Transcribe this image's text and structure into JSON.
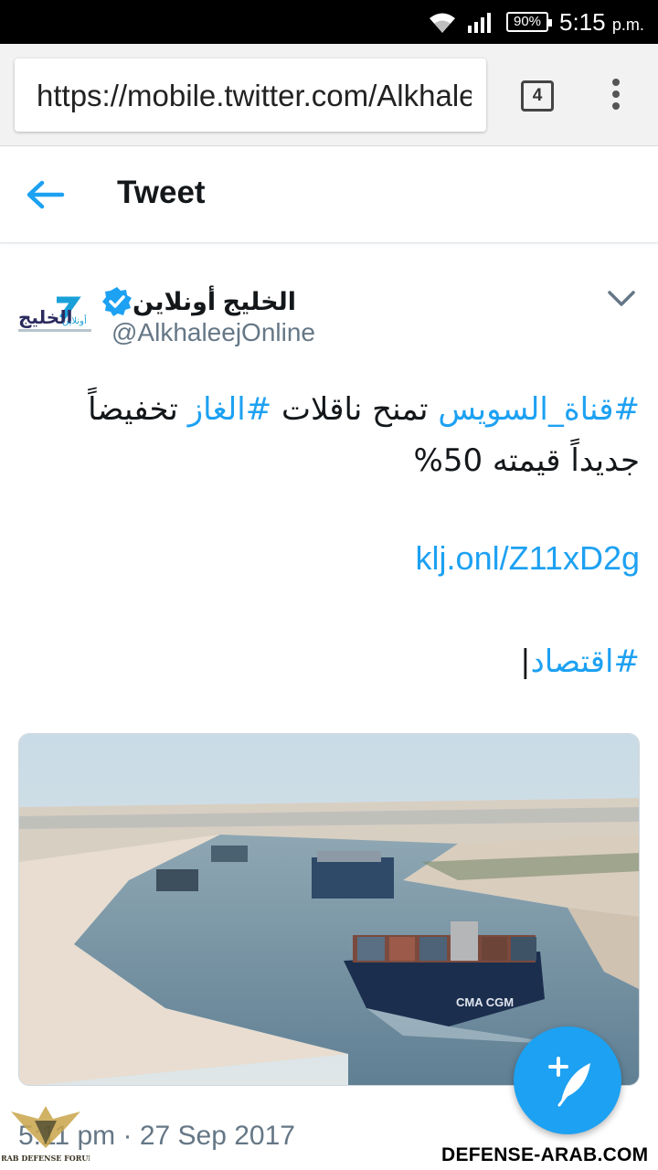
{
  "status_bar": {
    "battery": "90%",
    "time": "5:15",
    "ampm": "p.m.",
    "icons": [
      "wifi-icon",
      "signal-icon",
      "battery-icon"
    ]
  },
  "browser": {
    "url": "https://mobile.twitter.com/AlkhaleejOnline",
    "tab_count": "4",
    "icons": [
      "tab-switcher-icon",
      "overflow-menu-icon"
    ]
  },
  "header": {
    "title": "Tweet",
    "back_icon": "arrow-left-icon"
  },
  "author": {
    "display_name": "الخليج أونلاين",
    "handle": "@AlkhaleejOnline",
    "verified": true,
    "avatar_logo": "الخليج أونلاين"
  },
  "tweet": {
    "hashtag1": "#قناة_السويس",
    "text1": " تمنح ناقلات ",
    "hashtag2": "#الغاز",
    "text2": " تخفيضاً جديداً قيمته 50%",
    "link": "klj.onl/Z11xD2g",
    "tag_bar": "|",
    "hashtag3": "#اقتصاد",
    "timestamp": "5:11 pm · 27 Sep 2017"
  },
  "media": {
    "description_icon": "photo-icon"
  },
  "fab": {
    "icon": "compose-tweet-icon"
  },
  "watermark": {
    "site": "DEFENSE-ARAB.COM",
    "logo_text": "ARAB DEFENSE FORUM"
  },
  "colors": {
    "accent": "#1da1f2",
    "text": "#14171a",
    "secondary": "#657786"
  }
}
